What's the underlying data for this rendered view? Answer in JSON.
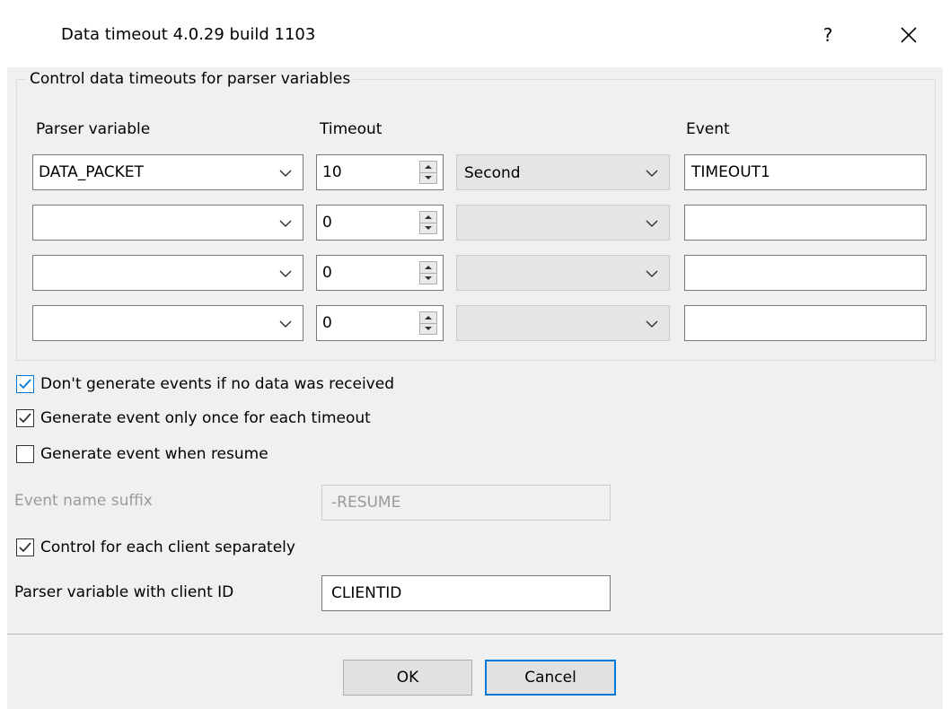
{
  "window": {
    "title": "Data timeout 4.0.29 build 1103",
    "help_label": "?",
    "close_icon": "close-icon"
  },
  "group": {
    "label": "Control data timeouts for parser variables",
    "columns": {
      "parser_variable": "Parser variable",
      "timeout": "Timeout",
      "event": "Event"
    },
    "rows": [
      {
        "variable": "DATA_PACKET",
        "timeout": "10",
        "unit": "Second",
        "event": "TIMEOUT1",
        "unit_enabled": true
      },
      {
        "variable": "",
        "timeout": "0",
        "unit": "",
        "event": "",
        "unit_enabled": false
      },
      {
        "variable": "",
        "timeout": "0",
        "unit": "",
        "event": "",
        "unit_enabled": false
      },
      {
        "variable": "",
        "timeout": "0",
        "unit": "",
        "event": "",
        "unit_enabled": false
      }
    ]
  },
  "options": {
    "no_data_events": {
      "label": "Don't generate events if no data was received",
      "checked": true
    },
    "once_per_timeout": {
      "label": "Generate event only once for each timeout",
      "checked": true
    },
    "event_on_resume": {
      "label": "Generate event when resume",
      "checked": false
    },
    "event_suffix_label": "Event name suffix",
    "event_suffix_value": "-RESUME",
    "per_client": {
      "label": "Control for each client separately",
      "checked": true
    },
    "client_id_label": "Parser variable with client ID",
    "client_id_value": "CLIENTID"
  },
  "buttons": {
    "ok": "OK",
    "cancel": "Cancel"
  },
  "colors": {
    "accent": "#0078d7",
    "dialog_bg": "#f0f0f0"
  }
}
